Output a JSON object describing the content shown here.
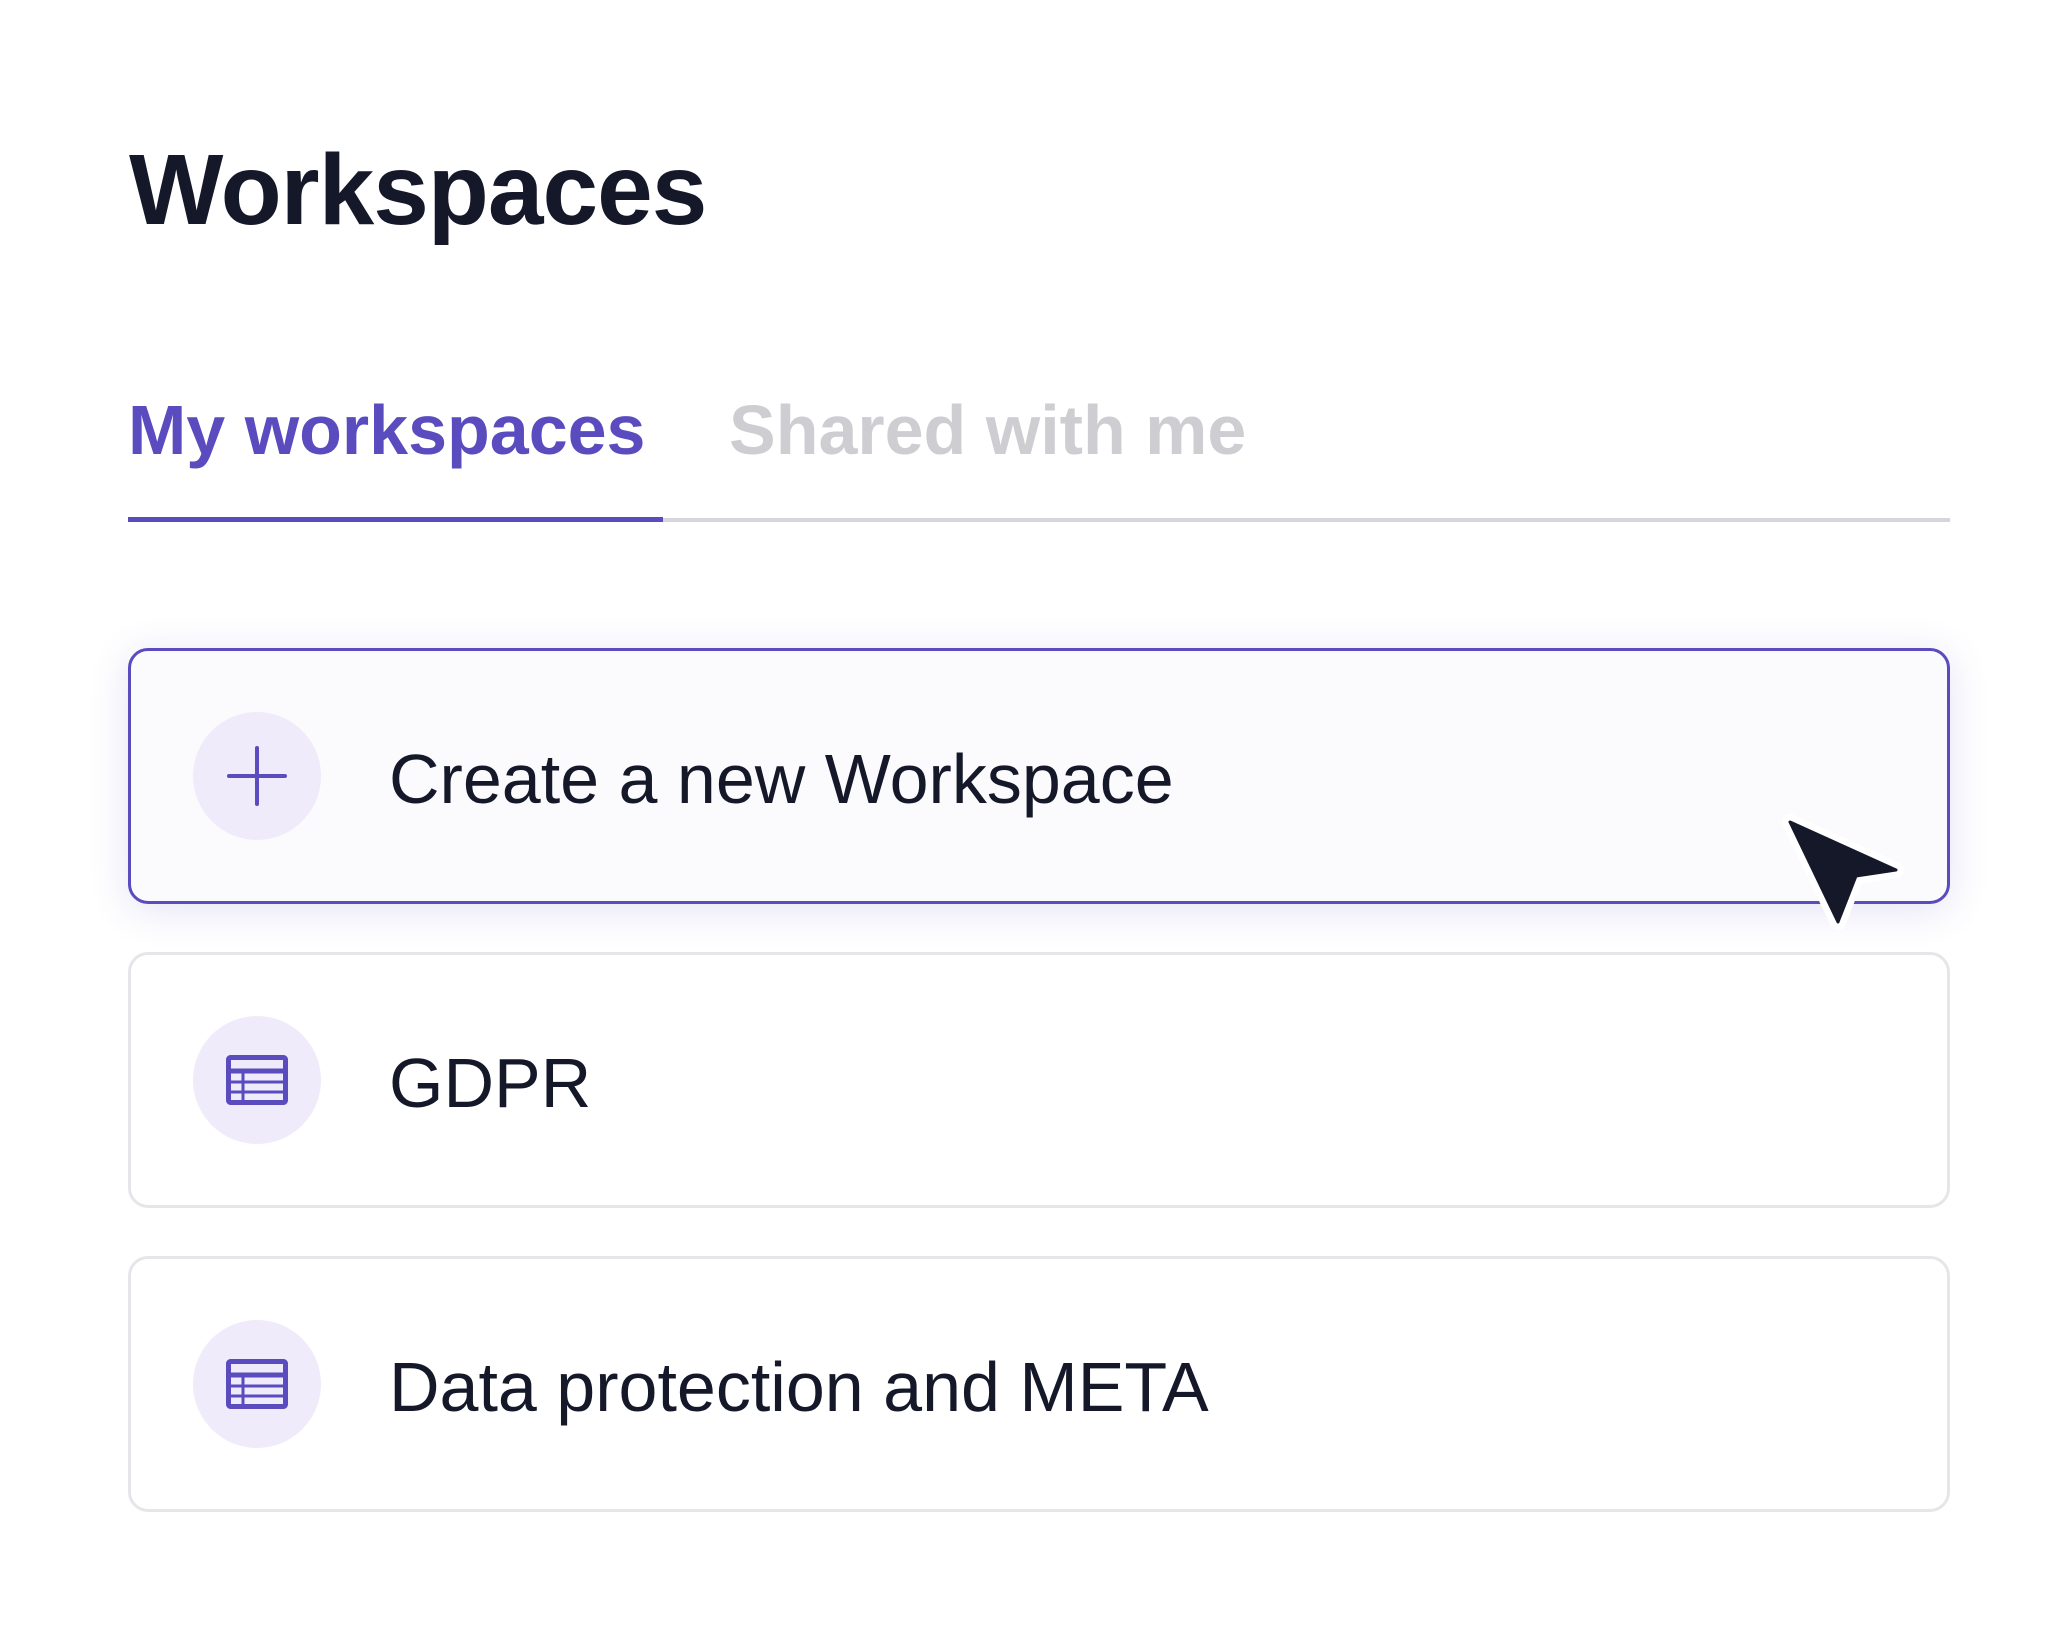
{
  "page": {
    "title": "Workspaces"
  },
  "tabs": [
    {
      "label": "My workspaces",
      "active": true
    },
    {
      "label": "Shared with me",
      "active": false
    }
  ],
  "workspaces": {
    "create": {
      "label": "Create a new Workspace",
      "icon": "plus-icon"
    },
    "items": [
      {
        "label": "GDPR",
        "icon": "table-icon"
      },
      {
        "label": "Data protection and META",
        "icon": "table-icon"
      }
    ]
  },
  "colors": {
    "accent": "#5a4bbf",
    "text": "#141829",
    "inactive_tab": "#cdcdd2",
    "icon_bg": "#efebfa",
    "card_border": "#e6e6ea"
  }
}
